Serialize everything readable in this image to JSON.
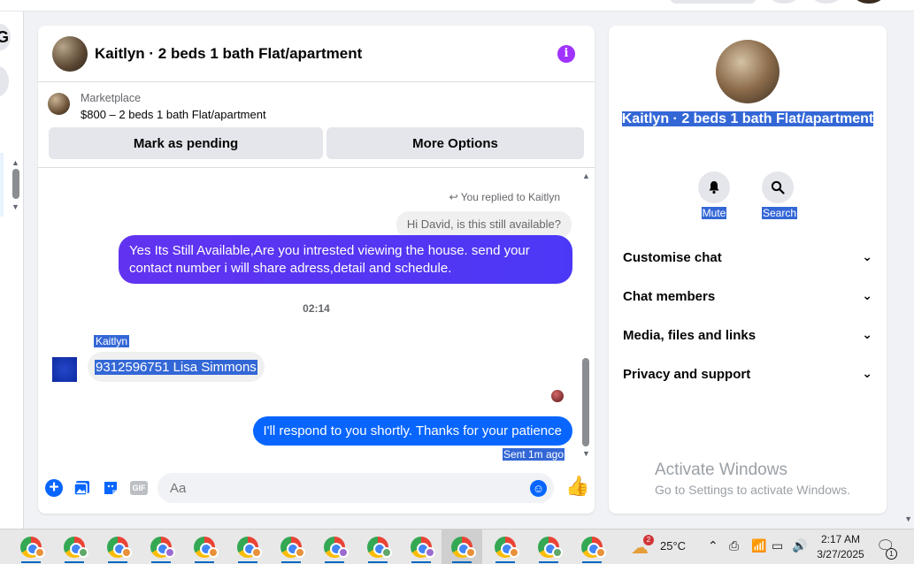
{
  "conversation": {
    "title": "Kaitlyn · 2 beds 1 bath Flat/apartment",
    "info_icon": "info-icon"
  },
  "listing": {
    "source": "Marketplace",
    "summary": "$800 – 2 beds 1 bath Flat/apartment",
    "mark_pending_label": "Mark as pending",
    "more_options_label": "More Options"
  },
  "messages": {
    "replied_note": "You replied to Kaitlyn",
    "quoted_message": "Hi David, is this still available?",
    "outgoing_1": "Yes Its Still Available,Are you intrested viewing the house. send your contact number i will share adress,detail and schedule.",
    "timestamp": "02:14",
    "incoming_sender": "Kaitlyn",
    "incoming_1": "9312596751 Lisa Simmons",
    "outgoing_2": "I'll respond to you shortly. Thanks for your patience",
    "sent_status": "Sent 1m ago"
  },
  "composer": {
    "placeholder": "Aa",
    "icons": [
      "plus-icon",
      "photo-icon",
      "sticker-icon",
      "gif-icon",
      "emoji-icon",
      "thumbs-up-icon"
    ],
    "gif_label": "GIF"
  },
  "sidebar": {
    "name": "Kaitlyn · 2 beds 1 bath Flat/apartment",
    "actions": [
      {
        "label": "Mute",
        "icon": "bell-icon"
      },
      {
        "label": "Search",
        "icon": "search-icon"
      }
    ],
    "sections": [
      {
        "label": "Customise chat"
      },
      {
        "label": "Chat members"
      },
      {
        "label": "Media, files and links"
      },
      {
        "label": "Privacy and support"
      }
    ]
  },
  "watermark": {
    "line1": "Activate Windows",
    "line2": "Go to Settings to activate Windows."
  },
  "taskbar": {
    "weather_badge": "2",
    "temperature": "25°C",
    "time": "2:17 AM",
    "date": "3/27/2025",
    "notification_count": "1"
  },
  "colors": {
    "accent_blue": "#0866ff",
    "outgoing_purple": "#5035f3",
    "info_purple": "#a033ff",
    "selection_blue": "#3367d6"
  }
}
